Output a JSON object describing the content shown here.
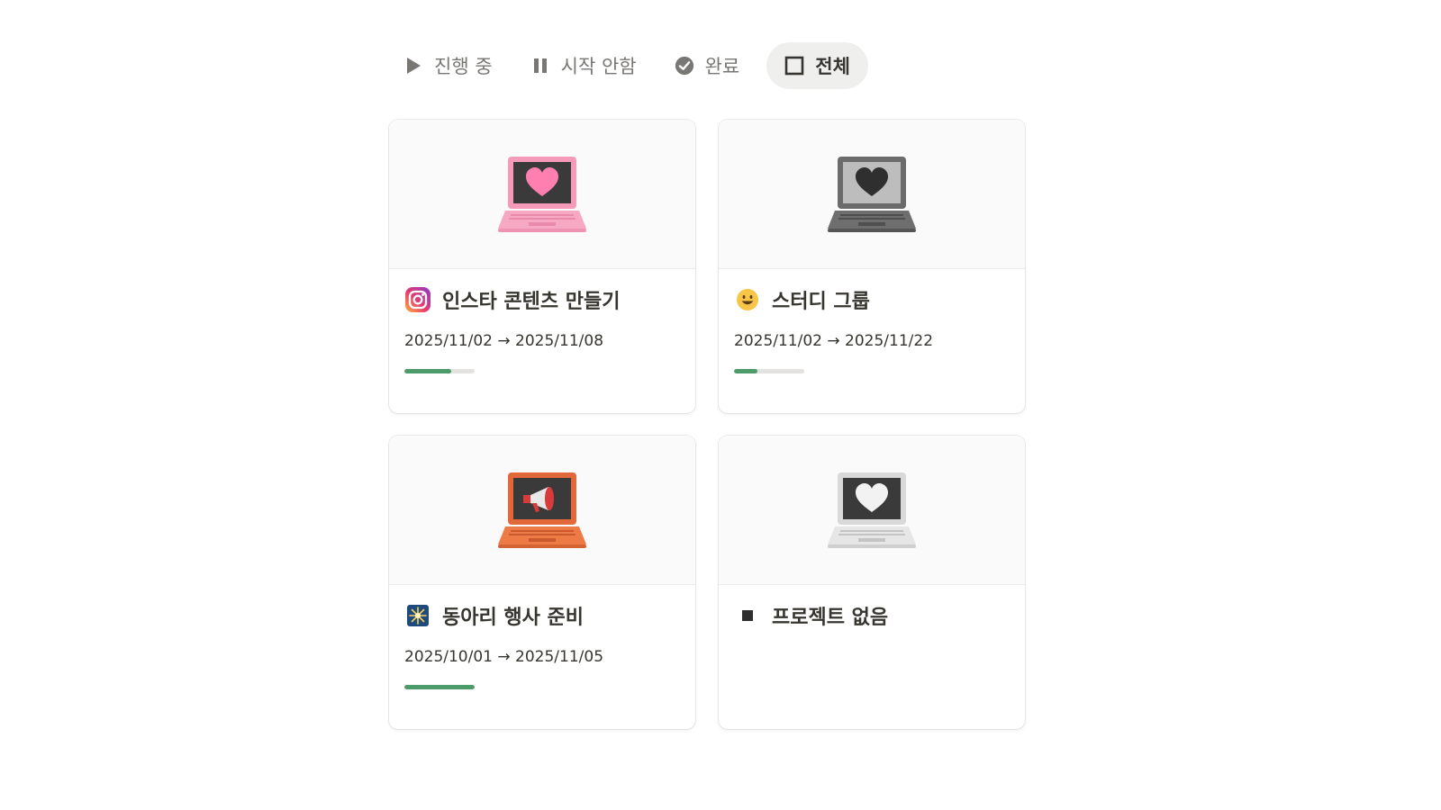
{
  "tabs": [
    {
      "label": "진행 중",
      "icon": "play-icon",
      "active": false
    },
    {
      "label": "시작 안함",
      "icon": "pause-icon",
      "active": false
    },
    {
      "label": "완료",
      "icon": "check-circle-icon",
      "active": false
    },
    {
      "label": "전체",
      "icon": "square-icon",
      "active": true
    }
  ],
  "projects": [
    {
      "title": "인스타 콘텐츠 만들기",
      "icon": "instagram-icon",
      "cover": "pink-laptop-heart",
      "dates": "2025/11/02 → 2025/11/08",
      "progress": 0.67
    },
    {
      "title": "스터디 그룹",
      "icon": "smiley-icon",
      "cover": "gray-laptop-heart",
      "dates": "2025/11/02 → 2025/11/22",
      "progress": 0.33
    },
    {
      "title": "동아리 행사 준비",
      "icon": "sparkler-icon",
      "cover": "orange-laptop-megaphone",
      "dates": "2025/10/01 → 2025/11/05",
      "progress": 1.0
    },
    {
      "title": "프로젝트 없음",
      "icon": "black-square-icon",
      "cover": "white-laptop-heart",
      "dates": "",
      "progress": null
    }
  ],
  "colors": {
    "progress_fill": "#4d9b68",
    "progress_track": "#e3e2e0",
    "active_tab_bg": "#efefee"
  }
}
